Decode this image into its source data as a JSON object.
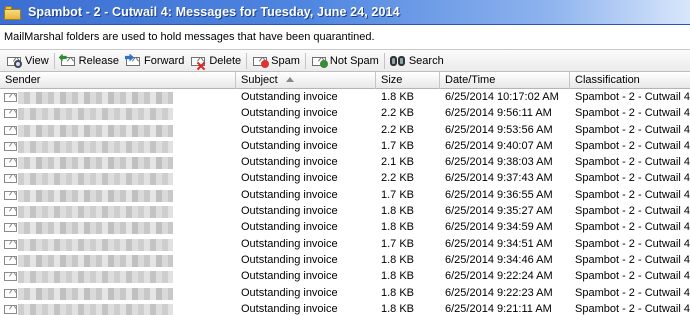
{
  "window": {
    "title": "Spambot - 2 - Cutwail 4: Messages for Tuesday, June 24, 2014"
  },
  "info_text": "MailMarshal folders are used to hold messages that have been quarantined.",
  "toolbar": {
    "view": "View",
    "release": "Release",
    "forward": "Forward",
    "delete": "Delete",
    "spam": "Spam",
    "not_spam": "Not Spam",
    "search": "Search"
  },
  "columns": {
    "sender": "Sender",
    "subject": "Subject",
    "size": "Size",
    "datetime": "Date/Time",
    "classification": "Classification",
    "sorted_by": "subject",
    "sort_direction": "ascending"
  },
  "messages": [
    {
      "subject": "Outstanding invoice",
      "size": "1.8 KB",
      "datetime": "6/25/2014 10:17:02 AM",
      "classification": "Spambot - 2 - Cutwail 4"
    },
    {
      "subject": "Outstanding invoice",
      "size": "2.2 KB",
      "datetime": "6/25/2014 9:56:11 AM",
      "classification": "Spambot - 2 - Cutwail 4"
    },
    {
      "subject": "Outstanding invoice",
      "size": "2.2 KB",
      "datetime": "6/25/2014 9:53:56 AM",
      "classification": "Spambot - 2 - Cutwail 4"
    },
    {
      "subject": "Outstanding invoice",
      "size": "1.7 KB",
      "datetime": "6/25/2014 9:40:07 AM",
      "classification": "Spambot - 2 - Cutwail 4"
    },
    {
      "subject": "Outstanding invoice",
      "size": "2.1 KB",
      "datetime": "6/25/2014 9:38:03 AM",
      "classification": "Spambot - 2 - Cutwail 4"
    },
    {
      "subject": "Outstanding invoice",
      "size": "2.2 KB",
      "datetime": "6/25/2014 9:37:43 AM",
      "classification": "Spambot - 2 - Cutwail 4"
    },
    {
      "subject": "Outstanding invoice",
      "size": "1.7 KB",
      "datetime": "6/25/2014 9:36:55 AM",
      "classification": "Spambot - 2 - Cutwail 4"
    },
    {
      "subject": "Outstanding invoice",
      "size": "1.8 KB",
      "datetime": "6/25/2014 9:35:27 AM",
      "classification": "Spambot - 2 - Cutwail 4"
    },
    {
      "subject": "Outstanding invoice",
      "size": "1.8 KB",
      "datetime": "6/25/2014 9:34:59 AM",
      "classification": "Spambot - 2 - Cutwail 4"
    },
    {
      "subject": "Outstanding invoice",
      "size": "1.7 KB",
      "datetime": "6/25/2014 9:34:51 AM",
      "classification": "Spambot - 2 - Cutwail 4"
    },
    {
      "subject": "Outstanding invoice",
      "size": "1.8 KB",
      "datetime": "6/25/2014 9:34:46 AM",
      "classification": "Spambot - 2 - Cutwail 4"
    },
    {
      "subject": "Outstanding invoice",
      "size": "1.8 KB",
      "datetime": "6/25/2014 9:22:24 AM",
      "classification": "Spambot - 2 - Cutwail 4"
    },
    {
      "subject": "Outstanding invoice",
      "size": "1.8 KB",
      "datetime": "6/25/2014 9:22:23 AM",
      "classification": "Spambot - 2 - Cutwail 4"
    },
    {
      "subject": "Outstanding invoice",
      "size": "1.8 KB",
      "datetime": "6/25/2014 9:21:11 AM",
      "classification": "Spambot - 2 - Cutwail 4"
    }
  ],
  "colors": {
    "titlebar": "#4f86e0",
    "titlebar_text": "#ffffff"
  }
}
